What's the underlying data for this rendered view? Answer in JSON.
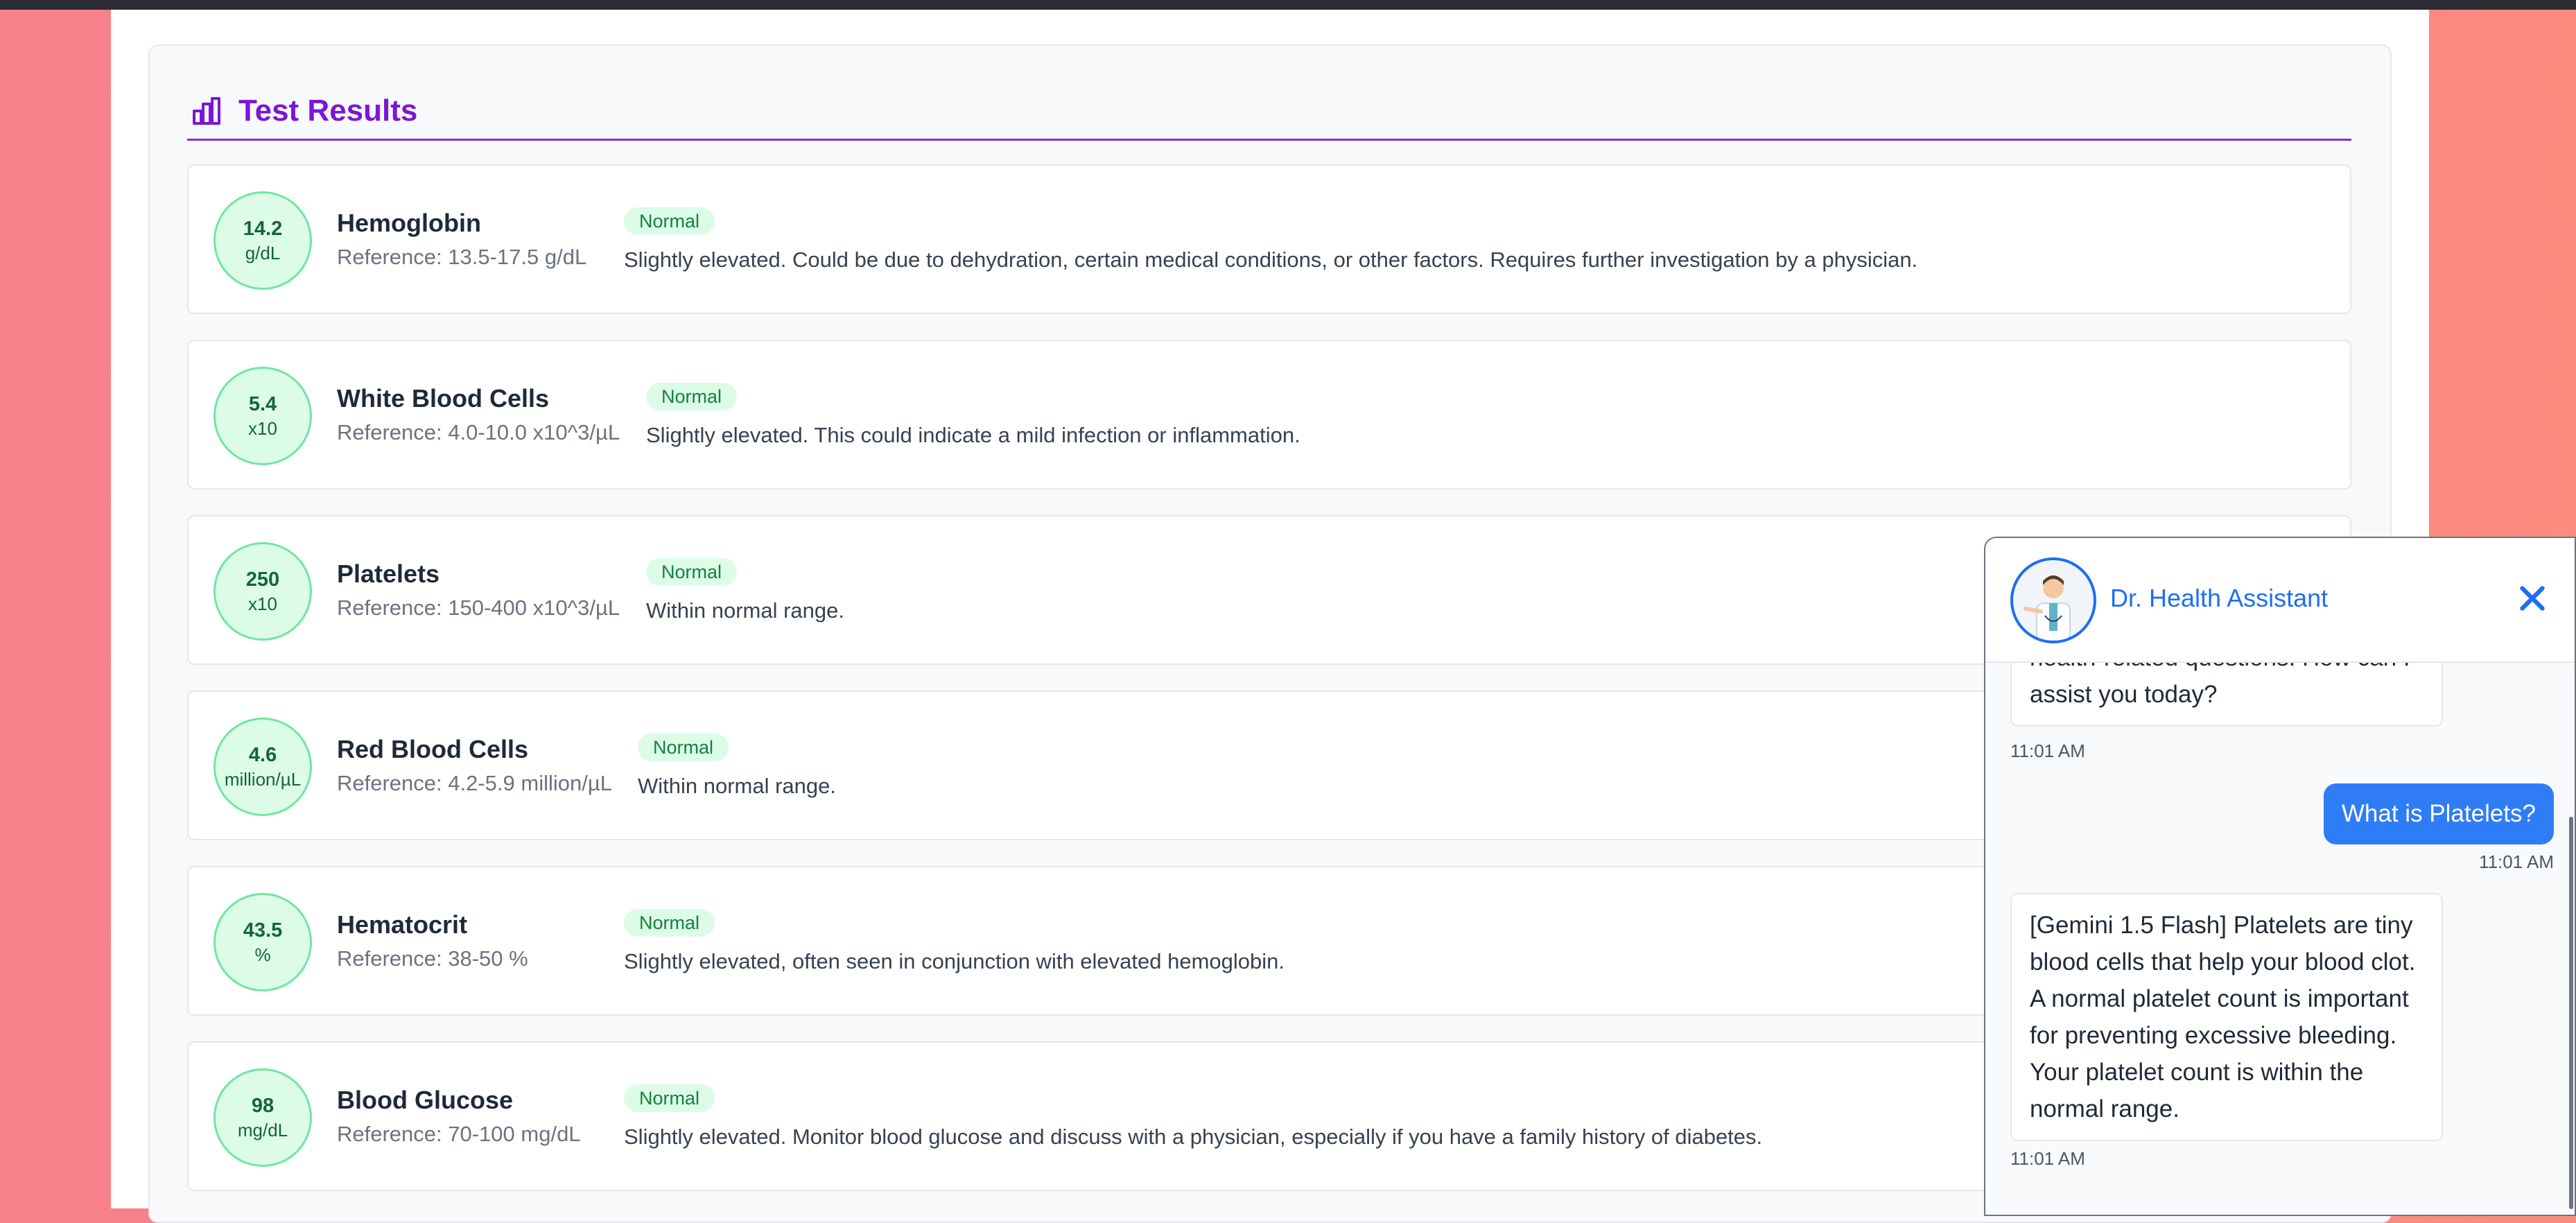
{
  "section": {
    "title": "Test Results",
    "icon": "bar-chart-icon",
    "accent": "#7b17d6"
  },
  "results": [
    {
      "value": "14.2",
      "unit": "g/dL",
      "name": "Hemoglobin",
      "reference": "Reference: 13.5-17.5 g/dL",
      "status": "Normal",
      "description": "Slightly elevated. Could be due to dehydration, certain medical conditions, or other factors. Requires further investigation by a physician."
    },
    {
      "value": "5.4",
      "unit": "x10",
      "name": "White Blood Cells",
      "reference": "Reference: 4.0-10.0 x10^3/µL",
      "status": "Normal",
      "description": "Slightly elevated. This could indicate a mild infection or inflammation."
    },
    {
      "value": "250",
      "unit": "x10",
      "name": "Platelets",
      "reference": "Reference: 150-400 x10^3/µL",
      "status": "Normal",
      "description": "Within normal range."
    },
    {
      "value": "4.6",
      "unit": "million/µL",
      "name": "Red Blood Cells",
      "reference": "Reference: 4.2-5.9 million/µL",
      "status": "Normal",
      "description": "Within normal range."
    },
    {
      "value": "43.5",
      "unit": "%",
      "name": "Hematocrit",
      "reference": "Reference: 38-50 %",
      "status": "Normal",
      "description": "Slightly elevated, often seen in conjunction with elevated hemoglobin."
    },
    {
      "value": "98",
      "unit": "mg/dL",
      "name": "Blood Glucose",
      "reference": "Reference: 70-100 mg/dL",
      "status": "Normal",
      "description": "Slightly elevated. Monitor blood glucose and discuss with a physician, especially if you have a family history of diabetes."
    }
  ],
  "chat": {
    "title": "Dr. Health Assistant",
    "avatar_icon": "doctor-avatar",
    "close_icon": "close-icon",
    "messages": [
      {
        "from": "bot",
        "text_lines": [
          "health-related questions. How can I",
          "assist you today?"
        ],
        "time": "11:01 AM"
      },
      {
        "from": "user",
        "text": "What is Platelets?",
        "time": "11:01 AM"
      },
      {
        "from": "bot",
        "text": "[Gemini 1.5 Flash] Platelets are tiny blood cells that help your blood clot. A normal platelet count is important for preventing excessive bleeding. Your platelet count is within the normal range.",
        "time": "11:01 AM"
      }
    ]
  },
  "colors": {
    "status_normal_bg": "#dcfce7",
    "status_normal_text": "#15803d",
    "chat_accent": "#1d6ef5",
    "user_bubble": "#2f7df6"
  }
}
